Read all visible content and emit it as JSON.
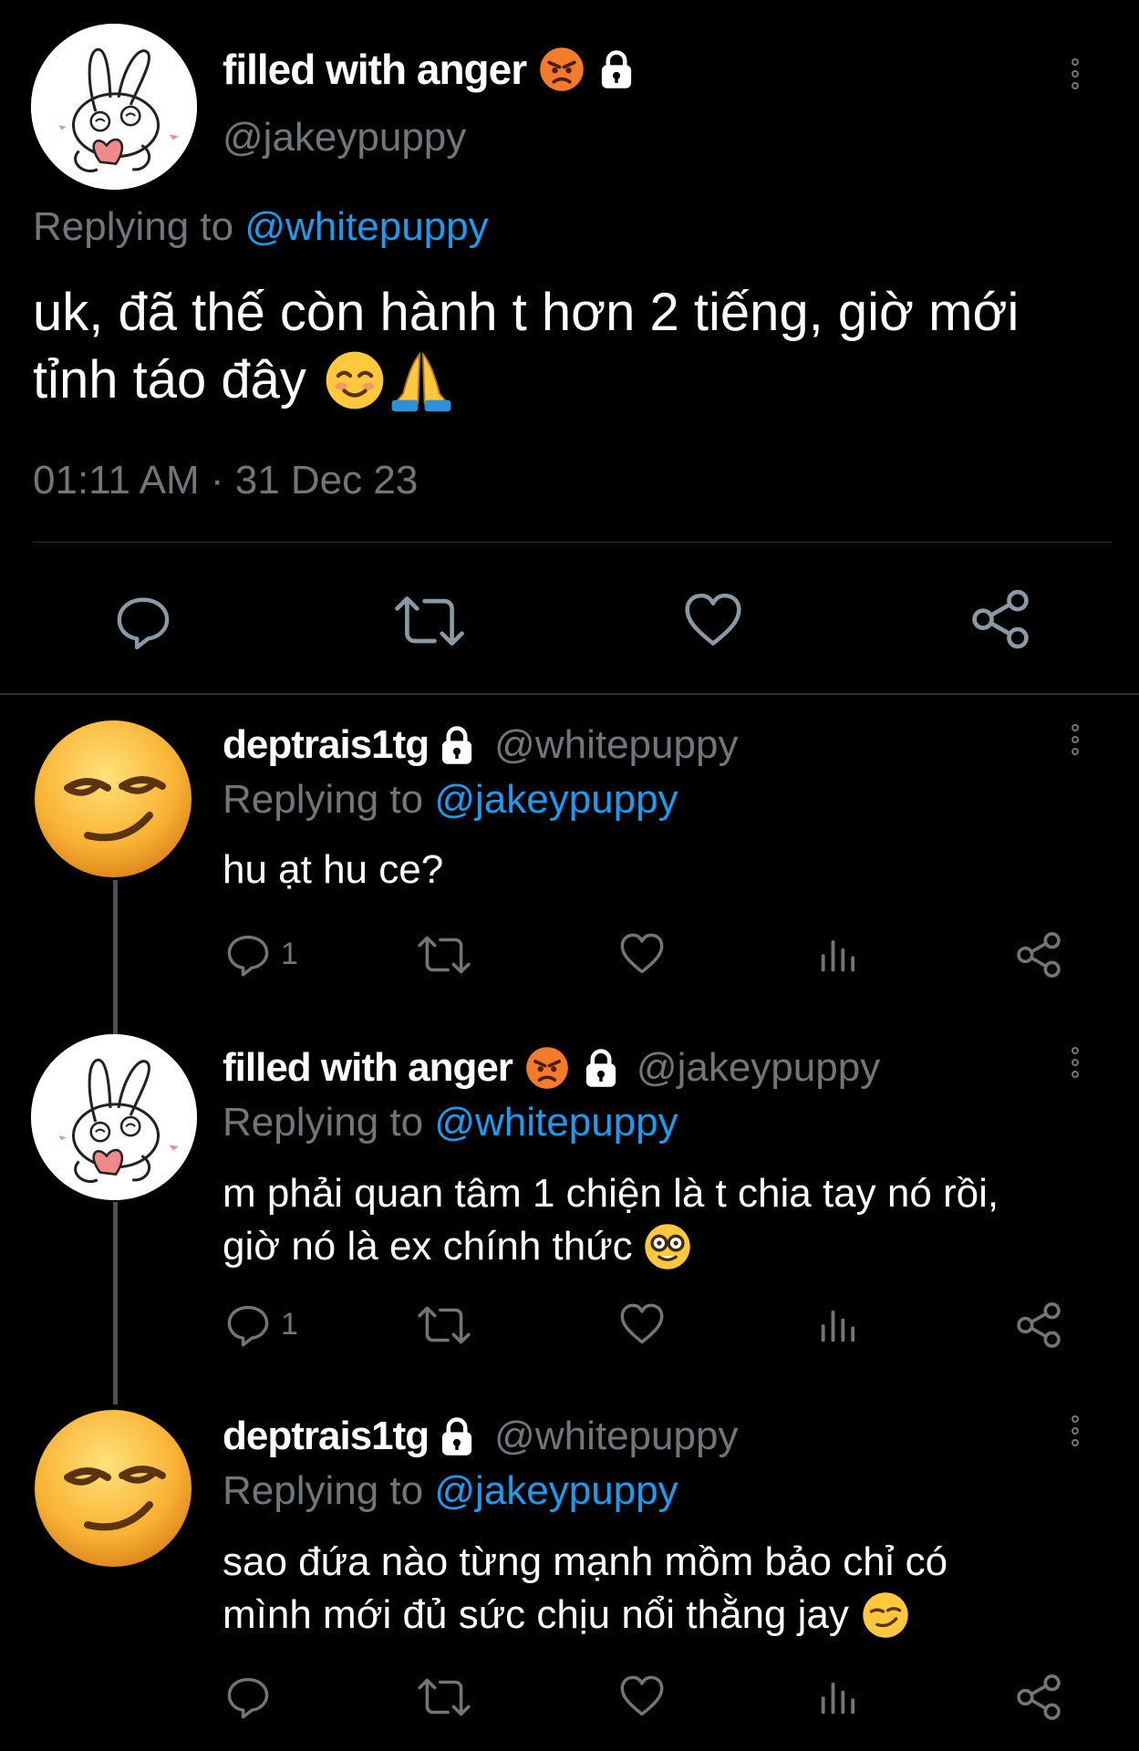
{
  "main": {
    "display_name": "filled with anger",
    "handle": "@jakeypuppy",
    "replying_prefix": "Replying to ",
    "replying_to": "@whitepuppy",
    "text_line1": "uk, đã thế còn hành t hơn 2 tiếng, giờ mới",
    "text_line2": "tỉnh táo đây",
    "timestamp": "01:11 AM · 31 Dec 23",
    "emojis": [
      "angry-face",
      "lock",
      "smiling-blush",
      "folded-hands"
    ]
  },
  "replies": [
    {
      "display_name": "deptrais1tg",
      "handle": "@whitepuppy",
      "replying_prefix": "Replying to ",
      "replying_to": "@jakeypuppy",
      "text_line1": "hu ạt hu ce?",
      "text_line2": "",
      "reply_count": "1"
    },
    {
      "display_name": "filled with anger",
      "handle": "@jakeypuppy",
      "replying_prefix": "Replying to ",
      "replying_to": "@whitepuppy",
      "text_line1": "m phải quan tâm 1 chiện là t chia tay nó rồi,",
      "text_line2": "giờ nó là ex chính thức",
      "reply_count": "1"
    },
    {
      "display_name": "deptrais1tg",
      "handle": "@whitepuppy",
      "replying_prefix": "Replying to ",
      "replying_to": "@jakeypuppy",
      "text_line1": "sao đứa nào từng mạnh mồm bảo chỉ có",
      "text_line2": "mình mới đủ sức chịu nổi thằng jay",
      "reply_count": ""
    }
  ],
  "colors": {
    "background": "#000000",
    "muted": "#71767b",
    "mention": "#1d9bf0",
    "text": "#ffffff"
  },
  "icons": [
    "comment-icon",
    "retweet-icon",
    "like-icon",
    "share-icon",
    "stats-icon",
    "more-icon",
    "lock-icon"
  ]
}
